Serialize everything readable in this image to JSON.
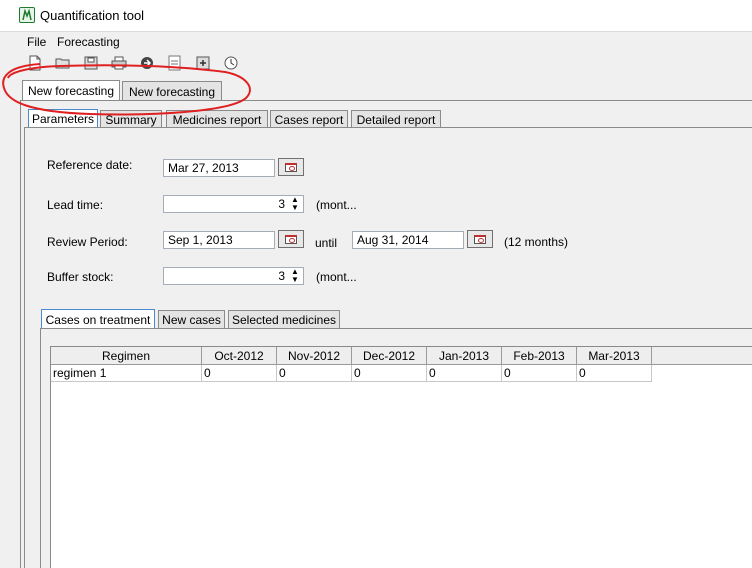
{
  "window": {
    "title": "Quantification tool"
  },
  "menu": {
    "items": [
      "File",
      "Forecasting"
    ]
  },
  "toolbar": {
    "icons": [
      "new-file-icon",
      "open-folder-icon",
      "save-icon",
      "print-icon",
      "go-icon",
      "export-icon",
      "add-icon",
      "clock-icon"
    ]
  },
  "doc_tabs": [
    "New forecasting",
    "New forecasting"
  ],
  "sub_tabs": [
    "Parameters",
    "Summary",
    "Medicines report",
    "Cases report",
    "Detailed report"
  ],
  "params": {
    "reference_date": {
      "label": "Reference date:",
      "value": "Mar 27, 2013"
    },
    "lead_time": {
      "label": "Lead time:",
      "value": "3",
      "unit": "(mont..."
    },
    "review_period": {
      "label": "Review Period:",
      "from": "Sep 1, 2013",
      "until_label": "until",
      "to": "Aug 31, 2014",
      "duration": "(12 months)"
    },
    "buffer_stock": {
      "label": "Buffer stock:",
      "value": "3",
      "unit": "(mont..."
    }
  },
  "case_tabs": [
    "Cases on treatment",
    "New cases",
    "Selected medicines"
  ],
  "table": {
    "columns": [
      "Regimen",
      "Oct-2012",
      "Nov-2012",
      "Dec-2012",
      "Jan-2013",
      "Feb-2013",
      "Mar-2013"
    ],
    "rows": [
      [
        "regimen 1",
        "0",
        "0",
        "0",
        "0",
        "0",
        "0"
      ]
    ]
  },
  "colors": {
    "annotation": "#e02020",
    "active_tab_border": "#4a8ad0"
  }
}
